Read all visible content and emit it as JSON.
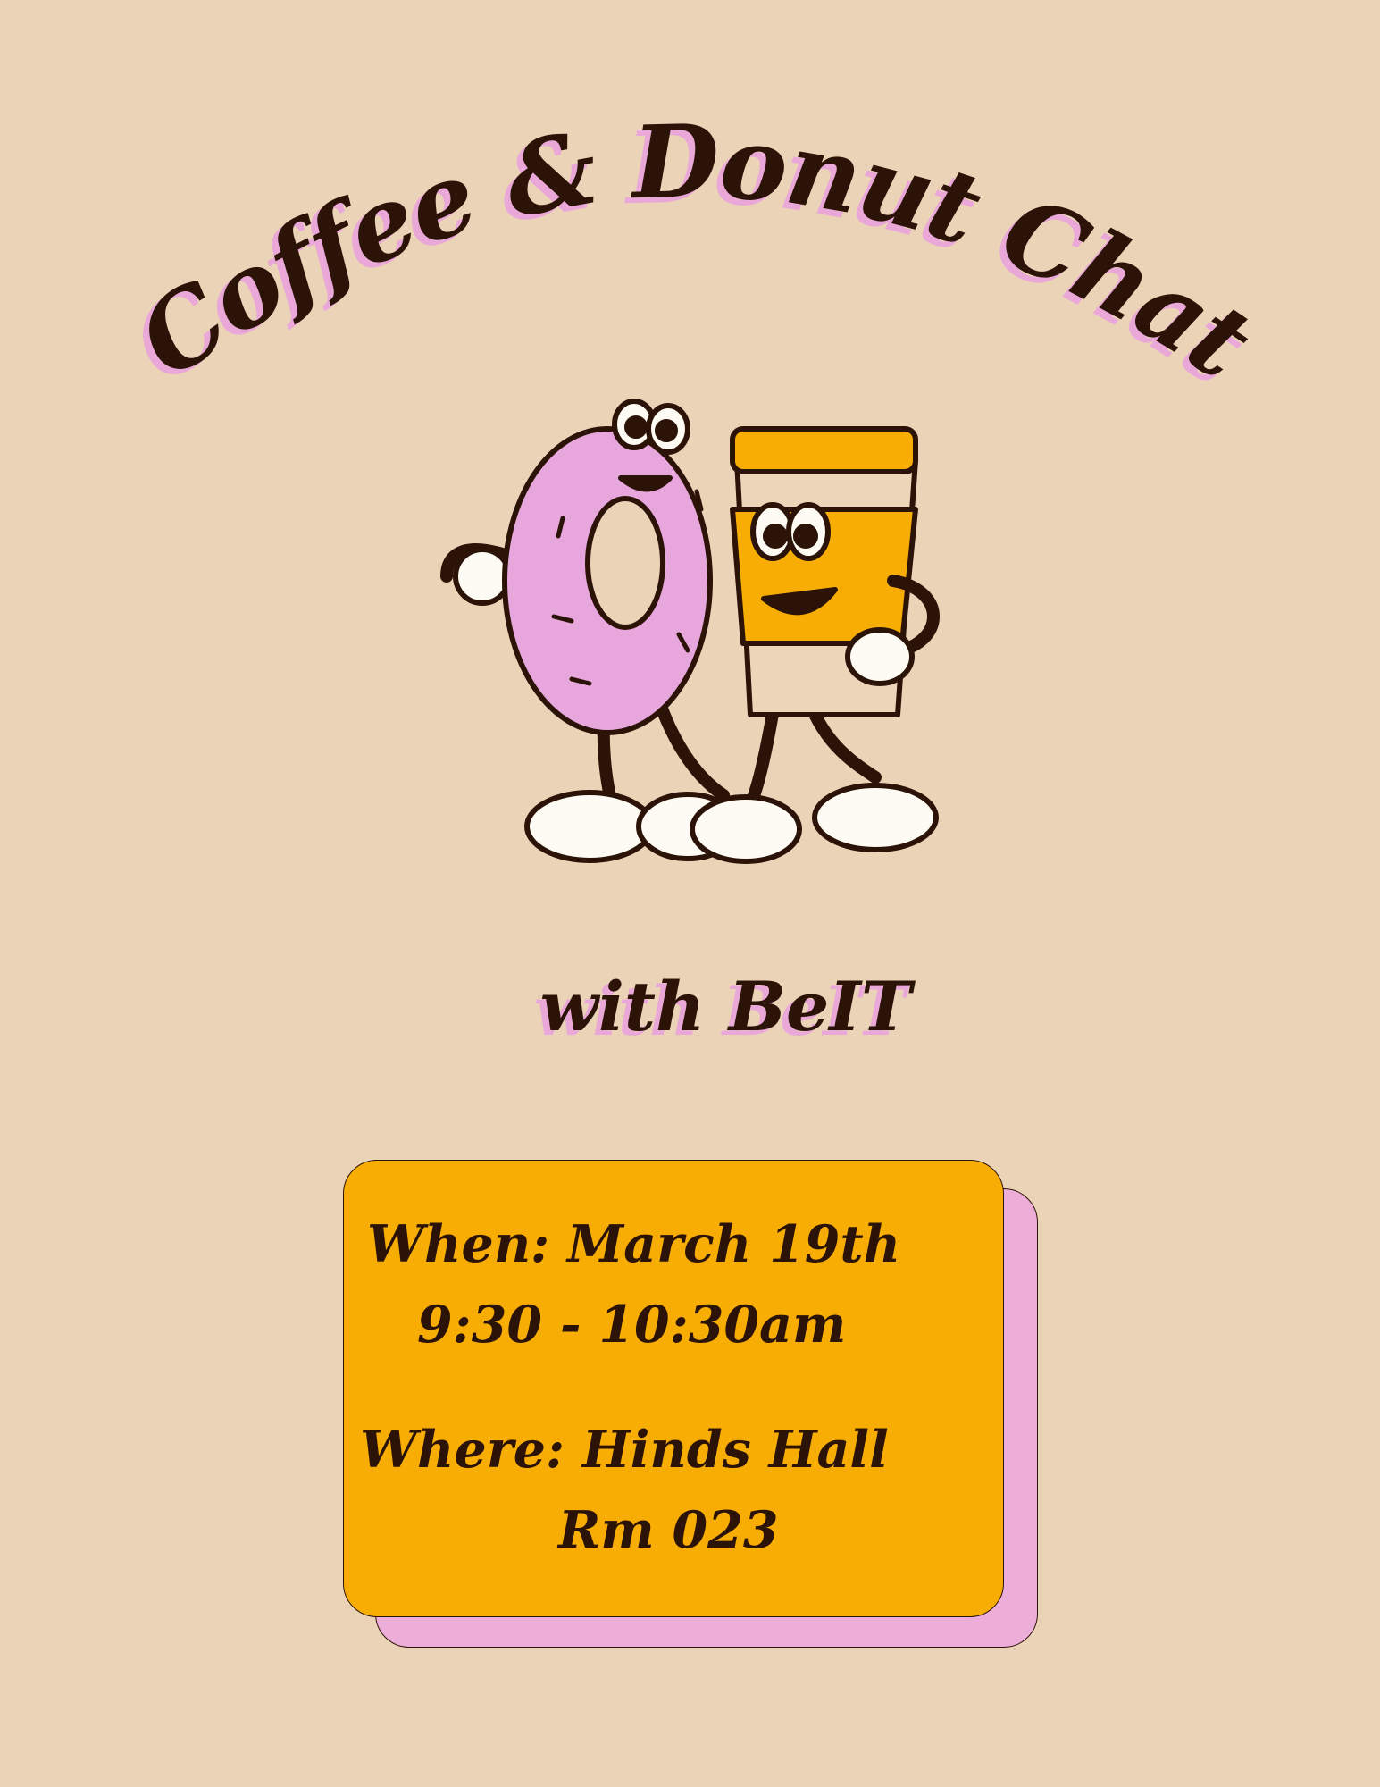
{
  "poster": {
    "title": "Coffee & Donut Chat",
    "subtitle": "with BeIT"
  },
  "details": {
    "when_line": "When: March 19th",
    "time_line": "9:30 - 10:30am",
    "where_line": "Where: Hinds Hall",
    "room_line": "Rm 023"
  },
  "colors": {
    "background": "#ebd3b8",
    "text_dark": "#2b1407",
    "accent_pink": "#eaa8d8",
    "card_orange": "#f8ad05",
    "donut_pink": "#e7a6dc",
    "cup_orange": "#f8ad05",
    "cup_cream": "#ecd5b8"
  },
  "illustration": {
    "name": "donut-and-coffee-cup-mascots"
  }
}
